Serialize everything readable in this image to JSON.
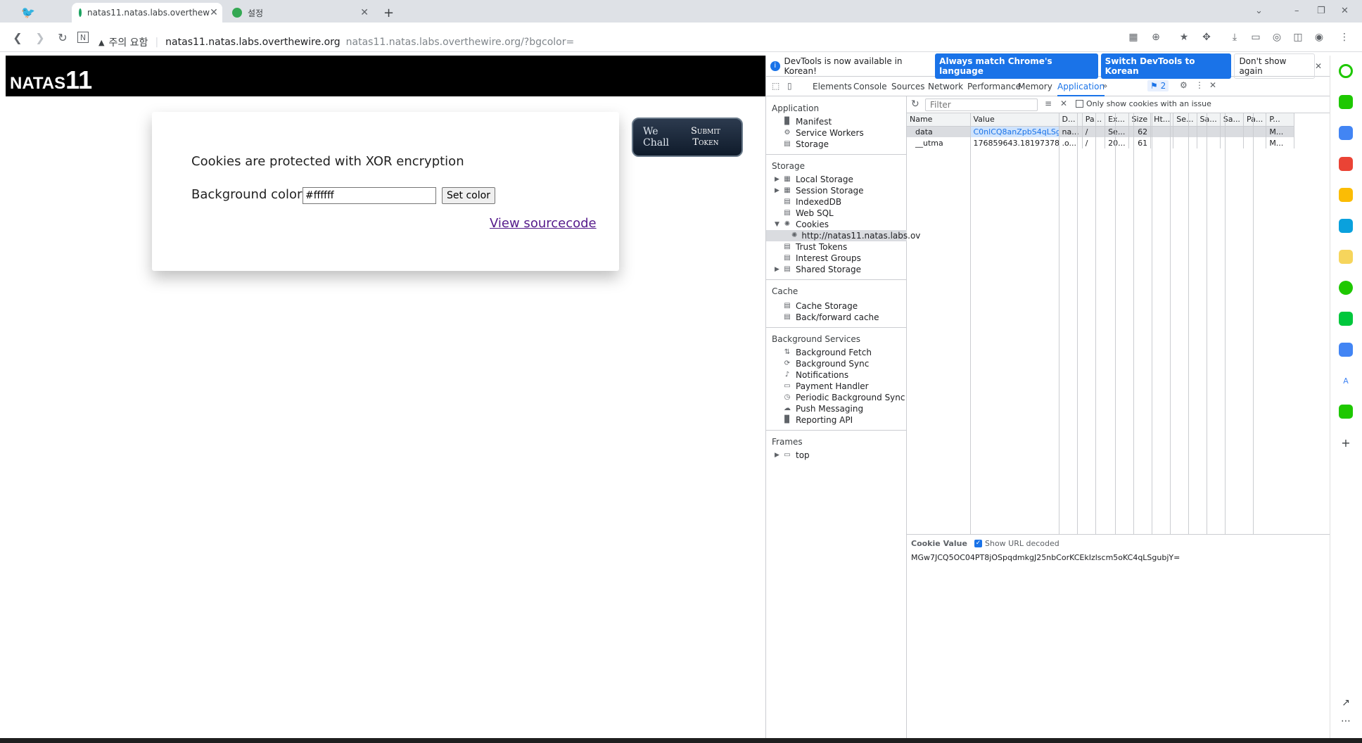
{
  "browser": {
    "tabs": [
      {
        "title": "natas11.natas.labs.overthew"
      },
      {
        "title": "설정"
      }
    ],
    "new_tab": "+",
    "security_label": "주의 요함",
    "url_host": "natas11.natas.labs.overthewire.org",
    "url_full": "natas11.natas.labs.overthewire.org/?bgcolor="
  },
  "page": {
    "header_text": "NATAS",
    "header_num": "11",
    "line1": "Cookies are protected with XOR encryption",
    "bg_label": "Background color:",
    "bg_value": "#ffffff",
    "set_color": "Set color",
    "view_source": "View sourcecode",
    "submit_line1": "Submit",
    "submit_line2": "Token",
    "wechall": "We Chall"
  },
  "devtools": {
    "infobar_text": "DevTools is now available in Korean!",
    "btn_match": "Always match Chrome's language",
    "btn_switch": "Switch DevTools to Korean",
    "btn_dont": "Don't show again",
    "tabs": [
      "Elements",
      "Console",
      "Sources",
      "Network",
      "Performance",
      "Memory",
      "Application"
    ],
    "issues_count": "2",
    "sidebar": {
      "application_title": "Application",
      "application_items": [
        "Manifest",
        "Service Workers",
        "Storage"
      ],
      "storage_title": "Storage",
      "storage_items": [
        "Local Storage",
        "Session Storage",
        "IndexedDB",
        "Web SQL",
        "Cookies"
      ],
      "cookie_origin": "http://natas11.natas.labs.ov",
      "storage_items2": [
        "Trust Tokens",
        "Interest Groups",
        "Shared Storage"
      ],
      "cache_title": "Cache",
      "cache_items": [
        "Cache Storage",
        "Back/forward cache"
      ],
      "bg_title": "Background Services",
      "bg_items": [
        "Background Fetch",
        "Background Sync",
        "Notifications",
        "Payment Handler",
        "Periodic Background Sync",
        "Push Messaging",
        "Reporting API"
      ],
      "frames_title": "Frames",
      "frames_items": [
        "top"
      ]
    },
    "filter_placeholder": "Filter",
    "only_issue": "Only show cookies with an issue",
    "columns": [
      "Name",
      "Value",
      "D...",
      "Pa...",
      "Ex...",
      "Size",
      "Ht...",
      "Se...",
      "Sa...",
      "Sa...",
      "Pa...",
      "P..."
    ],
    "rows": [
      [
        "data",
        "C0nlCQ8anZpbS4qLSguKmkz",
        "na...",
        "/",
        "Se...",
        "62",
        "",
        "",
        "",
        "",
        "",
        "M..."
      ],
      [
        "__utma",
        "176859643.1819737890.1...",
        ".o...",
        "/",
        "20...",
        "61",
        "",
        "",
        "",
        "",
        "",
        "M..."
      ]
    ],
    "cookie_value_label": "Cookie Value",
    "show_url_decoded": "Show URL decoded",
    "cookie_value": "MGw7JCQ5OC04PT8jOSpqdmkgJ25nbCorKCEkIzlscm5oKC4qLSgubjY="
  }
}
